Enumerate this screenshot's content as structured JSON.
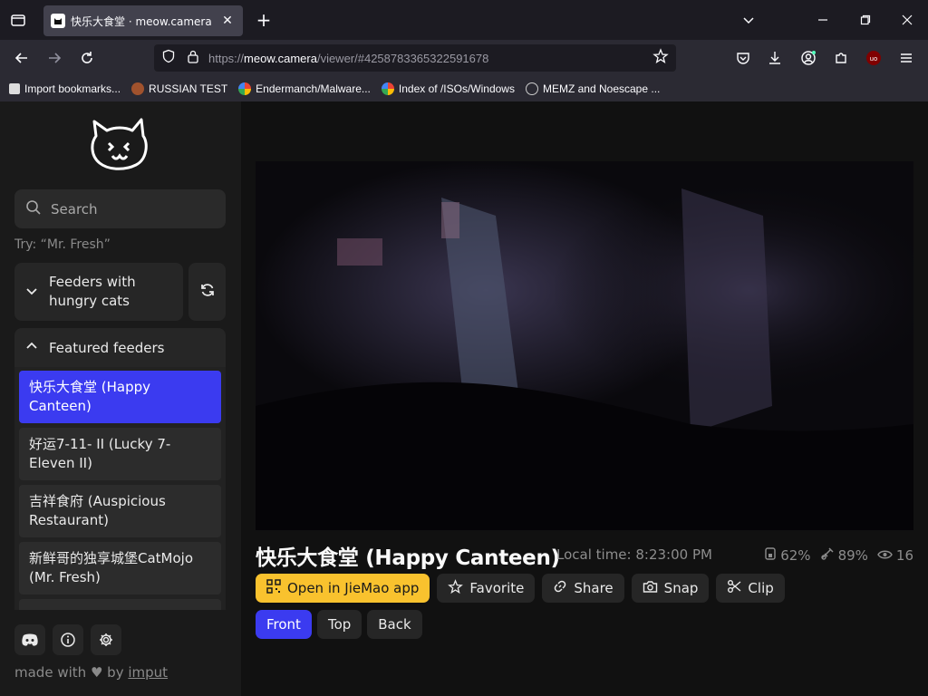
{
  "browser": {
    "tab_title": "快乐大食堂 · meow.camera",
    "url_prefix": "https://",
    "url_host": "meow.camera",
    "url_path": "/viewer/#4258783365322591678",
    "bookmarks": [
      {
        "label": "Import bookmarks...",
        "color": "#dddddd"
      },
      {
        "label": "RUSSIAN TEST",
        "color": "#a0522d"
      },
      {
        "label": "Endermanch/Malware...",
        "color": "#4285f4"
      },
      {
        "label": "Index of /ISOs/Windows",
        "color": "#4285f4"
      },
      {
        "label": "MEMZ and Noescape ...",
        "color": "#aaaaaa"
      }
    ]
  },
  "sidebar": {
    "search_placeholder": "Search",
    "try_hint": "Try: “Mr. Fresh”",
    "feeders_label": "Feeders with hungry cats",
    "featured_label": "Featured feeders",
    "feed_items": [
      {
        "label": "快乐大食堂 (Happy Canteen)",
        "active": true
      },
      {
        "label": "好运7-11- II (Lucky 7-Eleven II)",
        "active": false
      },
      {
        "label": "吉祥食府 (Auspicious Restaurant)",
        "active": false
      },
      {
        "label": "新鲜哥的独享城堡CatMojo (Mr. Fresh)",
        "active": false
      },
      {
        "label": "",
        "active": false
      }
    ],
    "made_with_prefix": "made with",
    "made_with_by": "by",
    "made_with_link": "imput"
  },
  "main": {
    "camera_title": "快乐大食堂 (Happy Canteen)",
    "local_time": "Local time: 8:23:00 PM",
    "stats": {
      "food": "62%",
      "battery": "89%",
      "viewers": "16"
    },
    "actions": {
      "open_app": "Open in JieMao app",
      "favorite": "Favorite",
      "share": "Share",
      "snap": "Snap",
      "clip": "Clip"
    },
    "views": [
      {
        "label": "Front",
        "active": true
      },
      {
        "label": "Top",
        "active": false
      },
      {
        "label": "Back",
        "active": false
      }
    ]
  },
  "colors": {
    "accent": "#3b3bf0",
    "primary_action": "#f9c22e"
  }
}
